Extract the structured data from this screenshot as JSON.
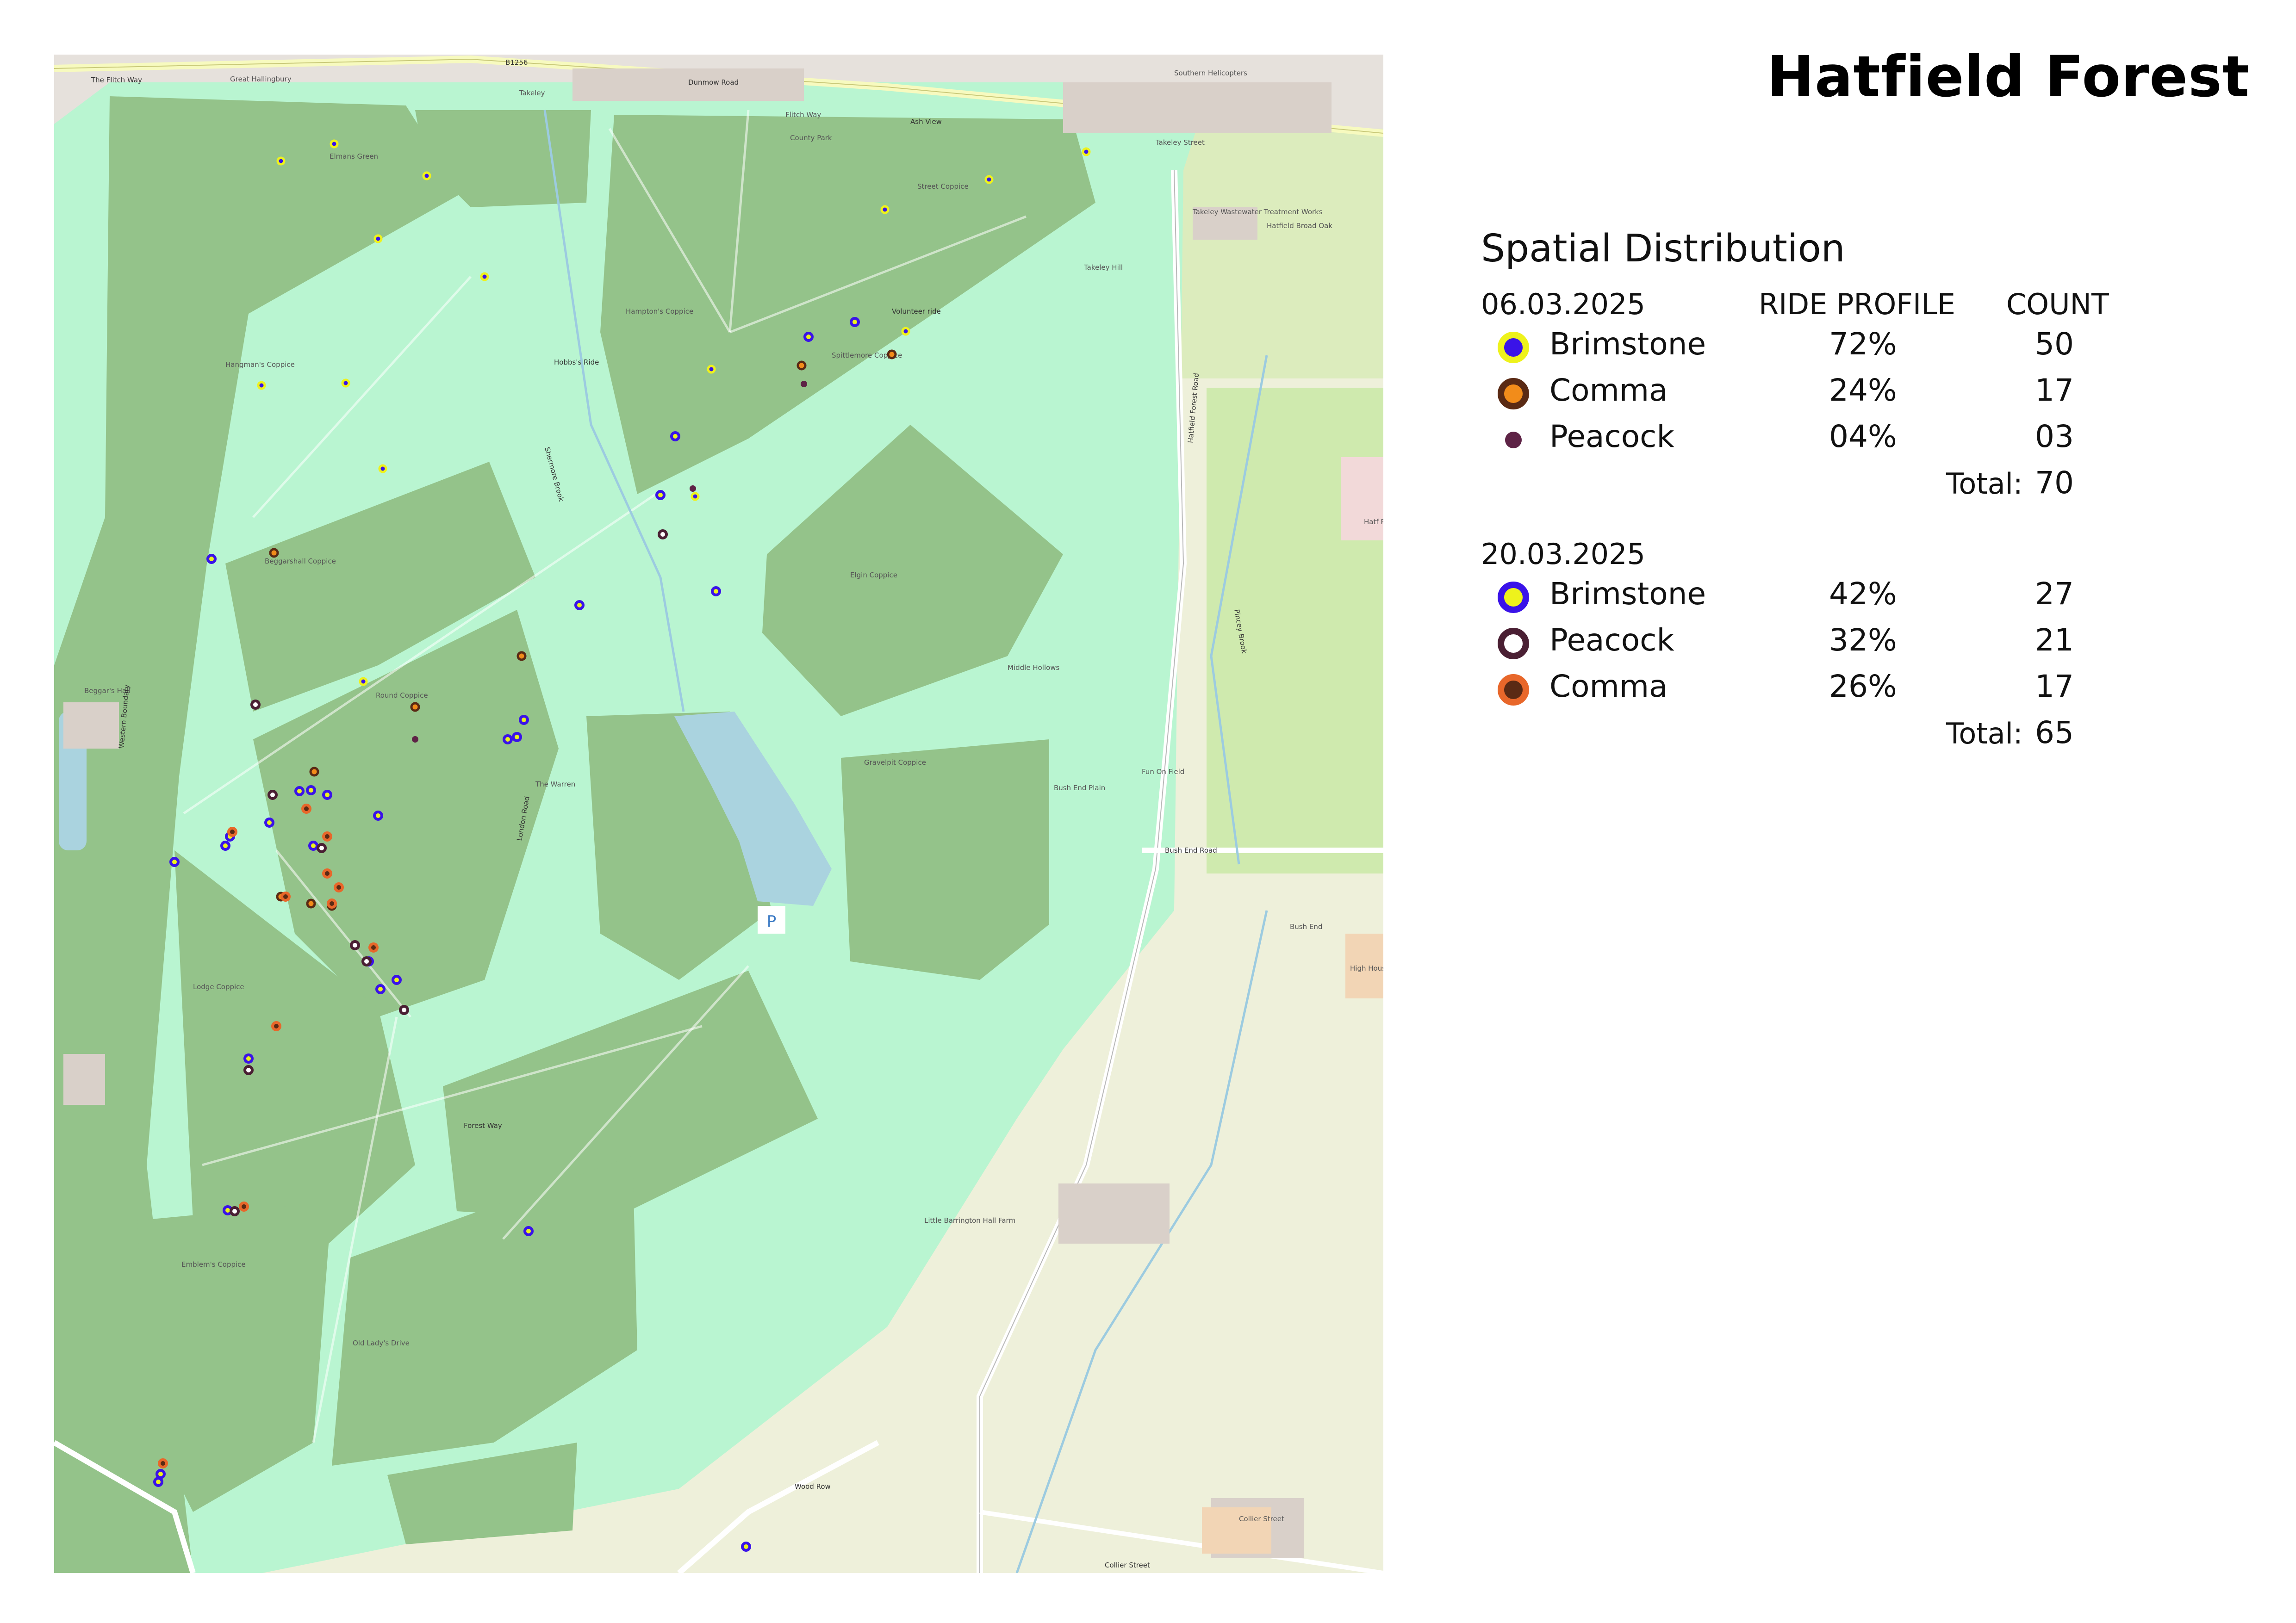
{
  "title": "Hatfield Forest",
  "legend": {
    "section_title": "Spatial Distribution",
    "header_ride": "RIDE PROFILE",
    "header_count": "COUNT",
    "total_label": "Total:",
    "surveys": [
      {
        "date": "06.03.2025",
        "rows": [
          {
            "name": "Brimstone",
            "pct": "72%",
            "count": "50",
            "fill": "#3a13e8",
            "ring": "#eef21c",
            "style": "ring"
          },
          {
            "name": "Comma",
            "pct": "24%",
            "count": "17",
            "fill": "#f28c1a",
            "ring": "#5a2a14",
            "style": "ring"
          },
          {
            "name": "Peacock",
            "pct": "04%",
            "count": "03",
            "fill": "#5e2346",
            "ring": "#5e2346",
            "style": "dot"
          }
        ],
        "total": "70"
      },
      {
        "date": "20.03.2025",
        "rows": [
          {
            "name": "Brimstone",
            "pct": "42%",
            "count": "27",
            "fill": "#eef21c",
            "ring": "#3a13e8",
            "style": "ring"
          },
          {
            "name": "Peacock",
            "pct": "32%",
            "count": "21",
            "fill": "#ffffff",
            "ring": "#4a1f33",
            "style": "ring"
          },
          {
            "name": "Comma",
            "pct": "26%",
            "count": "17",
            "fill": "#5a2a14",
            "ring": "#e8672a",
            "style": "ring"
          }
        ],
        "total": "65"
      }
    ]
  },
  "map": {
    "place_labels": [
      "Great Hallingbury",
      "Takeley",
      "Takeley Street",
      "Southern Helicopters",
      "Elmans Green",
      "Street Coppice",
      "Takeley Hill",
      "Takeley Wastewater Treatment Works",
      "Hatfield Broad Oak",
      "Hampton's Coppice",
      "Spittlemore Coppice",
      "Hangman's Coppice",
      "Beggarshall Coppice",
      "Beggar's Hall",
      "Round Coppice",
      "The Warren",
      "Elgin Coppice",
      "Middle Hollows",
      "Bush End Plain",
      "Fun On Field",
      "Gravelpit Coppice",
      "Lodge Coppice",
      "Emblem's Coppice",
      "Old Lady's Drive",
      "Little Barrington Hall Farm",
      "Bush End",
      "Collier Street",
      "High House Farm",
      "Flitch Way",
      "County Park",
      "Hatf Park"
    ],
    "road_labels": [
      "B1256",
      "Dunmow Road",
      "The Flitch Way",
      "Ash View",
      "Hatfield Forest Road",
      "Bush End Road",
      "London Road",
      "Forest Way",
      "Wood Row",
      "Collier Street",
      "Western Boundary",
      "Hobbs's Ride",
      "Volunteer ride",
      "Shermore Brook",
      "Pincey Brook"
    ],
    "brimstone_1": [
      [
        605,
        193
      ],
      [
        490,
        230
      ],
      [
        805,
        262
      ],
      [
        700,
        398
      ],
      [
        630,
        710
      ],
      [
        448,
        715
      ],
      [
        710,
        895
      ],
      [
        1420,
        680
      ],
      [
        930,
        480
      ],
      [
        2020,
        270
      ],
      [
        2230,
        210
      ],
      [
        1385,
        955
      ],
      [
        1840,
        598
      ],
      [
        668,
        1355
      ],
      [
        1795,
        335
      ]
    ],
    "brimstone_1_ring": [
      [
        340,
        1090
      ],
      [
        1730,
        578
      ],
      [
        1630,
        610
      ],
      [
        1342,
        825
      ],
      [
        1310,
        952
      ],
      [
        1135,
        1190
      ],
      [
        1015,
        1438
      ],
      [
        1000,
        1475
      ],
      [
        980,
        1480
      ],
      [
        465,
        1660
      ],
      [
        380,
        1690
      ],
      [
        260,
        1745
      ],
      [
        1430,
        1160
      ],
      [
        555,
        1590
      ],
      [
        590,
        1600
      ],
      [
        700,
        1645
      ],
      [
        560,
        1710
      ]
    ],
    "comma_1": [
      [
        475,
        1077
      ],
      [
        1010,
        1300
      ],
      [
        780,
        1410
      ],
      [
        562,
        1550
      ],
      [
        1615,
        672
      ],
      [
        1810,
        648
      ],
      [
        490,
        1820
      ],
      [
        555,
        1835
      ],
      [
        600,
        1840
      ]
    ],
    "peacock_1": [
      [
        1380,
        938
      ],
      [
        780,
        1480
      ],
      [
        1620,
        712
      ]
    ],
    "brimstone_2": [
      [
        530,
        1592
      ],
      [
        370,
        1710
      ],
      [
        680,
        1960
      ],
      [
        740,
        2000
      ],
      [
        705,
        2020
      ],
      [
        420,
        2170
      ],
      [
        375,
        2498
      ],
      [
        1025,
        2543
      ],
      [
        230,
        3068
      ],
      [
        1495,
        3225
      ],
      [
        225,
        3085
      ]
    ],
    "comma_2": [
      [
        385,
        1680
      ],
      [
        545,
        1630
      ],
      [
        590,
        1690
      ],
      [
        600,
        1835
      ],
      [
        500,
        1820
      ],
      [
        480,
        2100
      ],
      [
        410,
        2490
      ],
      [
        235,
        3045
      ],
      [
        590,
        1770
      ],
      [
        615,
        1800
      ],
      [
        690,
        1930
      ]
    ],
    "peacock_2": [
      [
        435,
        1405
      ],
      [
        472,
        1600
      ],
      [
        578,
        1715
      ],
      [
        650,
        1925
      ],
      [
        675,
        1960
      ],
      [
        756,
        2065
      ],
      [
        420,
        2195
      ],
      [
        1315,
        1037
      ],
      [
        390,
        2500
      ]
    ]
  }
}
